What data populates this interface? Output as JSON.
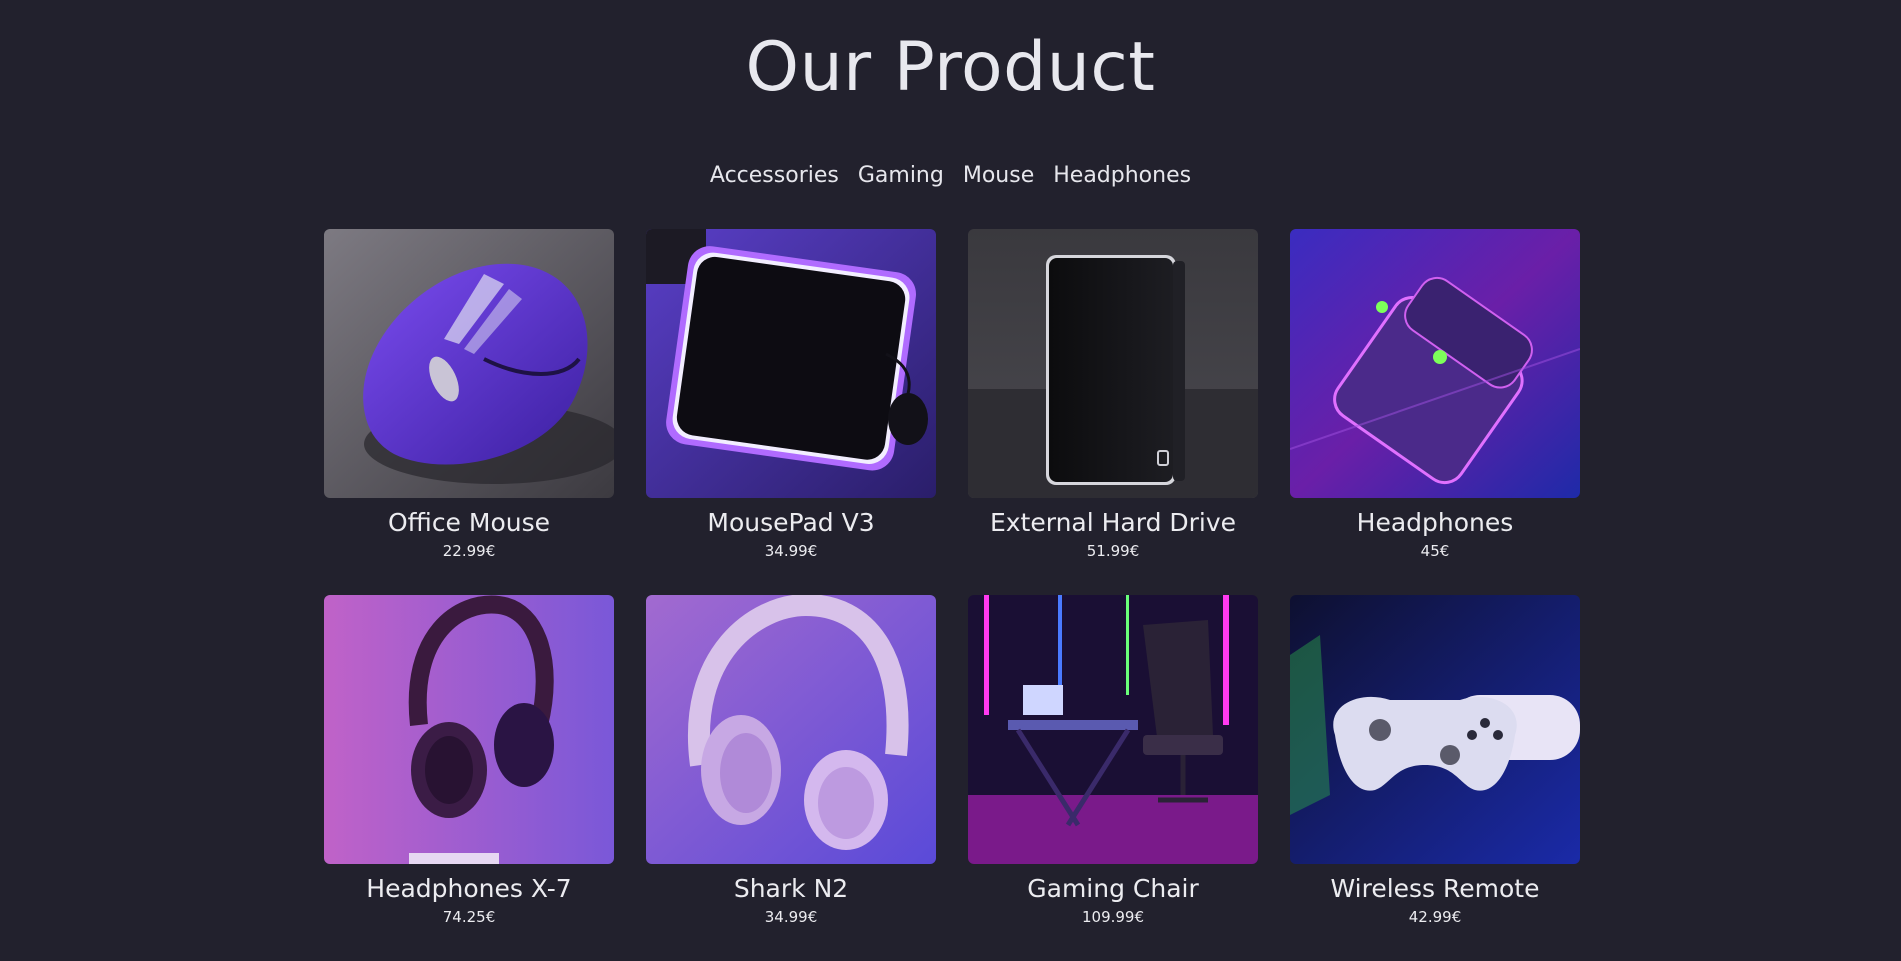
{
  "page_title": "Our Product",
  "filters": [
    "Accessories",
    "Gaming",
    "Mouse",
    "Headphones"
  ],
  "products": [
    {
      "name": "Office Mouse",
      "price": "22.99€",
      "image": "purple-mouse-photo"
    },
    {
      "name": "MousePad V3",
      "price": "34.99€",
      "image": "glowing-mousepad-photo"
    },
    {
      "name": "External Hard Drive",
      "price": "51.99€",
      "image": "hard-drive-photo"
    },
    {
      "name": "Headphones",
      "price": "45€",
      "image": "earbuds-case-photo"
    },
    {
      "name": "Headphones X-7",
      "price": "74.25€",
      "image": "dark-headphones-photo"
    },
    {
      "name": "Shark N2",
      "price": "34.99€",
      "image": "white-headphones-photo"
    },
    {
      "name": "Gaming Chair",
      "price": "109.99€",
      "image": "gaming-chair-photo"
    },
    {
      "name": "Wireless Remote",
      "price": "42.99€",
      "image": "game-controller-photo"
    }
  ],
  "colors": {
    "background": "#22212d",
    "text": "#ececf0"
  }
}
